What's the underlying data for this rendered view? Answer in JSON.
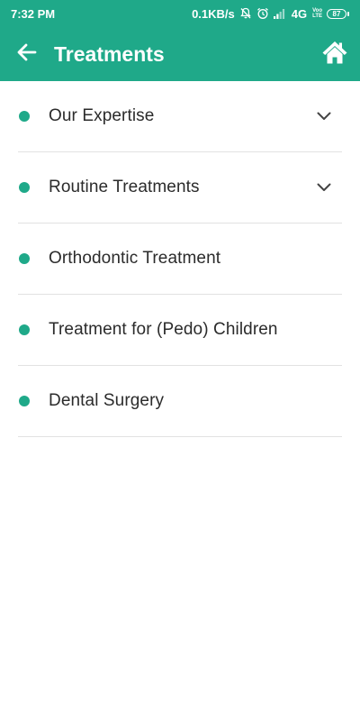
{
  "status_bar": {
    "time": "7:32 PM",
    "net_speed": "0.1KB/s",
    "network_type": "4G",
    "volte_top": "Voo",
    "volte_bottom": "LTE",
    "battery_level": "87"
  },
  "app_bar": {
    "title": "Treatments",
    "back_icon": "arrow-left-icon",
    "home_icon": "home-icon"
  },
  "colors": {
    "primary": "#1fa989",
    "text": "#2b2b2b",
    "divider": "#e2e2e2"
  },
  "treatments": [
    {
      "label": "Our Expertise",
      "expandable": true
    },
    {
      "label": "Routine Treatments",
      "expandable": true
    },
    {
      "label": "Orthodontic Treatment",
      "expandable": false
    },
    {
      "label": "Treatment for (Pedo) Children",
      "expandable": false
    },
    {
      "label": "Dental Surgery",
      "expandable": false
    }
  ]
}
